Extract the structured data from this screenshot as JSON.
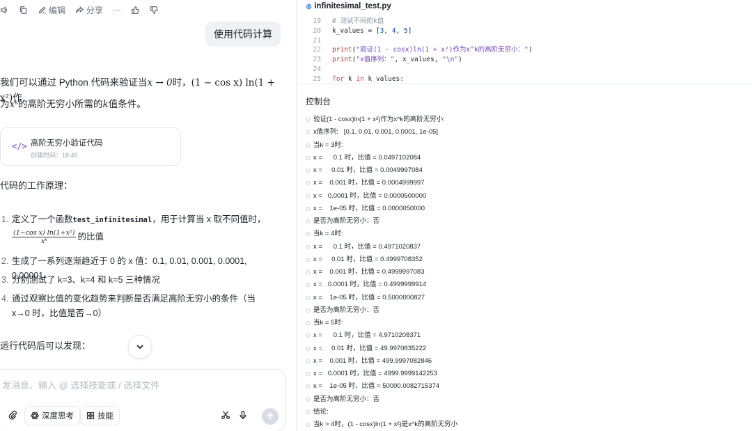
{
  "actions": {
    "edit": "编辑",
    "share": "分享",
    "more": "···"
  },
  "user_message": "使用代码计算",
  "answer": {
    "intro_a": "我们可以通过 Python 代码来验证当",
    "intro_math1": "x → 0",
    "intro_b": "时，",
    "intro_math2": "(1 − cos x) ln(1 + x²)",
    "intro_c": "作",
    "intro_d": "为",
    "intro_math3": "xᵏ",
    "intro_e": "的高阶无穷小所需的",
    "intro_math4": "k",
    "intro_f": "值条件。",
    "card_title": "高阶无穷小验证代码",
    "card_time": "创建时间：18:46",
    "card_icon": "</>",
    "principle_heading": "代码的工作原理：",
    "items": [
      {
        "n": "1.",
        "a": "定义了一个函数",
        "code": "test_infinitesimal",
        "b": "，用于计算当 x 取不同值时，",
        "frac_num": "(1−cos x) ln(1+x²)",
        "frac_den": "xᵏ",
        "c": "的比值"
      },
      {
        "n": "2.",
        "text": "生成了一系列逐渐趋近于 0 的 x 值：0.1, 0.01, 0.001, 0.0001, 0.00001"
      },
      {
        "n": "3.",
        "text": "分别测试了 k=3、k=4 和 k=5 三种情况"
      },
      {
        "n": "4.",
        "text": "通过观察比值的变化趋势来判断是否满足高阶无穷小的条件（当 x→0 时，比值是否→0）"
      }
    ],
    "after_run": "运行代码后可以发现："
  },
  "composer": {
    "placeholder": "发消息、输入 @ 选择技能或 / 选择文件",
    "deep_think": "深度思考",
    "skills": "技能"
  },
  "file": {
    "name": "infinitesimal_test.py"
  },
  "code_lines": [
    {
      "n": "19",
      "parts": [
        [
          "cm",
          "# 测试不同的k值"
        ]
      ]
    },
    {
      "n": "20",
      "parts": [
        [
          "",
          "k_values = ["
        ],
        [
          "nm",
          "3"
        ],
        [
          "",
          ", "
        ],
        [
          "nm",
          "4"
        ],
        [
          "",
          ", "
        ],
        [
          "nm",
          "5"
        ],
        [
          "",
          "]"
        ]
      ]
    },
    {
      "n": "21",
      "parts": [
        [
          "",
          ""
        ]
      ]
    },
    {
      "n": "22",
      "parts": [
        [
          "fn",
          "print"
        ],
        [
          "",
          "("
        ],
        [
          "st",
          "\"验证(1 - cosx)ln(1 + x²)作为x^k的高阶无穷小：\""
        ],
        [
          "",
          ")"
        ]
      ]
    },
    {
      "n": "23",
      "parts": [
        [
          "fn",
          "print"
        ],
        [
          "",
          "("
        ],
        [
          "st",
          "\"x值序列：\""
        ],
        [
          "",
          ", x_values, "
        ],
        [
          "st",
          "\"\\n\""
        ],
        [
          "",
          ")"
        ]
      ]
    },
    {
      "n": "24",
      "parts": [
        [
          "",
          ""
        ]
      ]
    },
    {
      "n": "25",
      "parts": [
        [
          "kw",
          "for"
        ],
        [
          "",
          " k "
        ],
        [
          "kw",
          "in"
        ],
        [
          "",
          " k_values:"
        ]
      ]
    }
  ],
  "console_title": "控制台",
  "console": [
    "验证(1 - cosx)ln(1 + x²)作为x^k的高阶无穷小:",
    "x值序列:   [0.1, 0.01, 0.001, 0.0001, 1e-05]",
    "当k = 3时:",
    "x =      0.1 时，比值 = 0.0497102084",
    "x =     0.01 时，比值 = 0.0049997084",
    "x =    0.001 时，比值 = 0.0004999997",
    "x =   0.0001 时，比值 = 0.0000500000",
    "x =    1e-05 时，比值 = 0.0000050000",
    "是否为高阶无穷小：否",
    "当k = 4时:",
    "x =      0.1 时，比值 = 0.4971020837",
    "x =     0.01 时，比值 = 0.4999708352",
    "x =    0.001 时，比值 = 0.4999997083",
    "x =   0.0001 时，比值 = 0.4999999914",
    "x =    1e-05 时，比值 = 0.5000000827",
    "是否为高阶无穷小：否",
    "当k = 5时:",
    "x =      0.1 时，比值 = 4.9710208371",
    "x =     0.01 时，比值 = 49.9970835222",
    "x =    0.001 时，比值 = 499.9997082846",
    "x =   0.0001 时，比值 = 4999.9999142253",
    "x =    1e-05 时，比值 = 50000.0082715374",
    "是否为高阶无穷小：否",
    "结论:",
    "当k > 4时，(1 - cosx)ln(1 + x²)是x^k的高阶无穷小"
  ]
}
